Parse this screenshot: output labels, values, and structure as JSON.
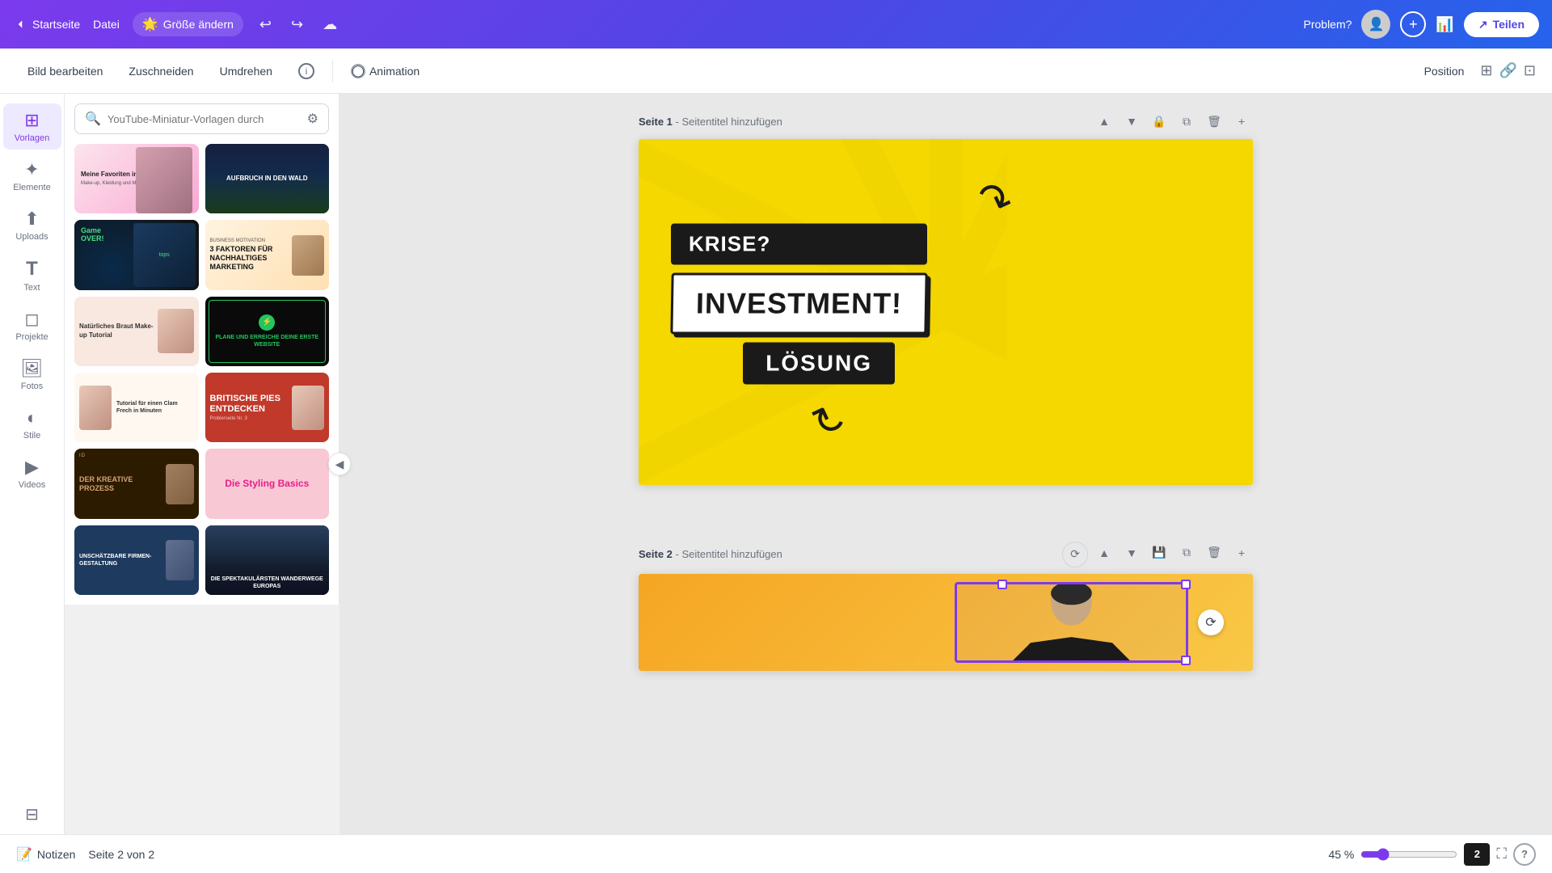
{
  "topBar": {
    "home": "Startseite",
    "file": "Datei",
    "resize": "Größe ändern",
    "problem": "Problem?",
    "share": "Teilen"
  },
  "secondBar": {
    "editImage": "Bild bearbeiten",
    "crop": "Zuschneiden",
    "flip": "Umdrehen",
    "animation": "Animation",
    "position": "Position"
  },
  "sidebar": {
    "items": [
      {
        "label": "Vorlagen",
        "icon": "⊞"
      },
      {
        "label": "Elemente",
        "icon": "✦"
      },
      {
        "label": "Uploads",
        "icon": "↑"
      },
      {
        "label": "Text",
        "icon": "T"
      },
      {
        "label": "Projekte",
        "icon": "□"
      },
      {
        "label": "Fotos",
        "icon": "🖼"
      },
      {
        "label": "Stile",
        "icon": "◐"
      },
      {
        "label": "Videos",
        "icon": "▶"
      }
    ]
  },
  "templatesPanel": {
    "searchPlaceholder": "YouTube-Miniatur-Vorlagen durch",
    "templates": [
      {
        "id": 1,
        "title": "Meine Favoriten im Juni",
        "subtitle": "Make-up, Kleidung und Musik",
        "bg": "#fce4ec",
        "textColor": "#333"
      },
      {
        "id": 2,
        "title": "AUFBRUCH IN DEN WALD",
        "bg": "#1a1a2e",
        "textColor": "#fff"
      },
      {
        "id": 3,
        "title": "Game OVER!",
        "bg": "#1a1a2e",
        "textColor": "#fff"
      },
      {
        "id": 4,
        "title": "3 FAKTOREN FÜR NACHHALTIGES MARKETING",
        "bg": "#fff3e0",
        "textColor": "#333"
      },
      {
        "id": 5,
        "title": "Natürliches Braut Make-up Tutorial",
        "bg": "#fce4ec",
        "textColor": "#333"
      },
      {
        "id": 6,
        "title": "PLANE UND ERREICHE DEINE ERSTE WEBSITE",
        "bg": "#1a1a1a",
        "textColor": "#00ff00"
      },
      {
        "id": 7,
        "title": "Tutorial für einen Clam Frech in Minuten",
        "bg": "#fff8f0",
        "textColor": "#333"
      },
      {
        "id": 8,
        "title": "BRITISCHE PIES ENTDECKEN",
        "bg": "#c0392b",
        "textColor": "#fff"
      },
      {
        "id": 9,
        "title": "DER KREATIVE PROZESS",
        "bg": "#2d1b00",
        "textColor": "#fff"
      },
      {
        "id": 10,
        "title": "Die Styling Basics",
        "bg": "#f8c8d4",
        "textColor": "#333"
      },
      {
        "id": 11,
        "title": "Unschätzbare Firmengestaltung",
        "bg": "#1e3a5f",
        "textColor": "#fff"
      },
      {
        "id": 12,
        "title": "DIE SPEKTAKULÄRSTEN WANDERWEGE EUROPAS",
        "bg": "#0d1b2a",
        "textColor": "#fff"
      }
    ]
  },
  "pages": [
    {
      "id": 1,
      "label": "Seite 1",
      "subtitle": "Seitentitel hinzufügen",
      "slide": {
        "words": [
          "KRISE?",
          "INVESTMENT!",
          "LÖSUNG"
        ]
      }
    },
    {
      "id": 2,
      "label": "Seite 2",
      "subtitle": "Seitentitel hinzufügen"
    }
  ],
  "bottomBar": {
    "notes": "Notizen",
    "pageIndicator": "Seite 2 von 2",
    "zoom": "45 %",
    "pageCount": "2"
  },
  "floatToolbar": {
    "copy": "⧉",
    "delete": "🗑",
    "more": "···"
  }
}
